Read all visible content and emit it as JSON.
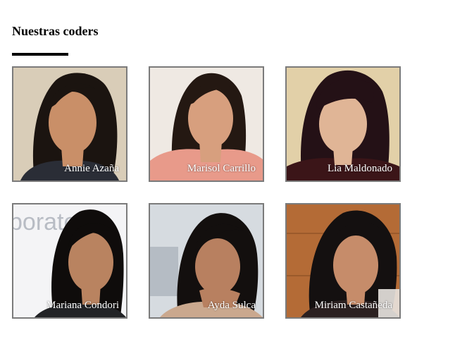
{
  "section": {
    "title": "Nuestras coders"
  },
  "coders": [
    {
      "name": "Annie Azaña",
      "background": "#d9cdb8",
      "skin": "#c98f68",
      "hair": "#1b1410",
      "clothing": "#2a2d36"
    },
    {
      "name": "Marisol Carrillo",
      "background": "#efe9e3",
      "skin": "#d79f7e",
      "hair": "#241812",
      "clothing": "#e89a8a"
    },
    {
      "name": "Lia Maldonado",
      "background": "#e2d0a8",
      "skin": "#e0b596",
      "hair": "#241116",
      "clothing": "#3b1518"
    },
    {
      "name": "Mariana Condori",
      "background": "#f4f4f6",
      "skin": "#b98360",
      "hair": "#0f0c0b",
      "clothing": "#222326",
      "text_overlay": "boratori"
    },
    {
      "name": "Ayda Sulca",
      "background": "#d6dbe0",
      "skin": "#b88060",
      "hair": "#130f0e",
      "clothing": "#caa88e"
    },
    {
      "name": "Miriam Castañeda",
      "background": "#b46b36",
      "skin": "#c68c6a",
      "hair": "#141010",
      "clothing": "#2b2020"
    }
  ]
}
